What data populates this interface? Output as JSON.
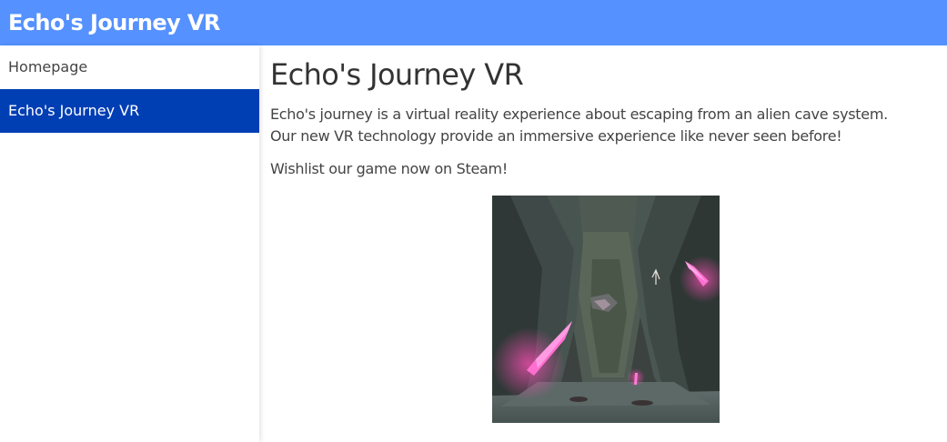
{
  "header": {
    "site_title": "Echo's Journey VR"
  },
  "sidebar": {
    "items": [
      {
        "label": "Homepage",
        "active": false
      },
      {
        "label": "Echo's Journey VR",
        "active": true
      }
    ]
  },
  "main": {
    "title": "Echo's Journey VR",
    "description_line1": "Echo's journey is a virtual reality experience about escaping from an alien cave system.",
    "description_line2": "Our new VR technology provide an immersive experience like never seen before!",
    "cta": "Wishlist our game now on Steam!",
    "image": {
      "icon": "game-screenshot-cave"
    }
  },
  "colors": {
    "topbar": "#5591ff",
    "active_nav": "#003eb4",
    "crystal": "#ff5fc8"
  }
}
